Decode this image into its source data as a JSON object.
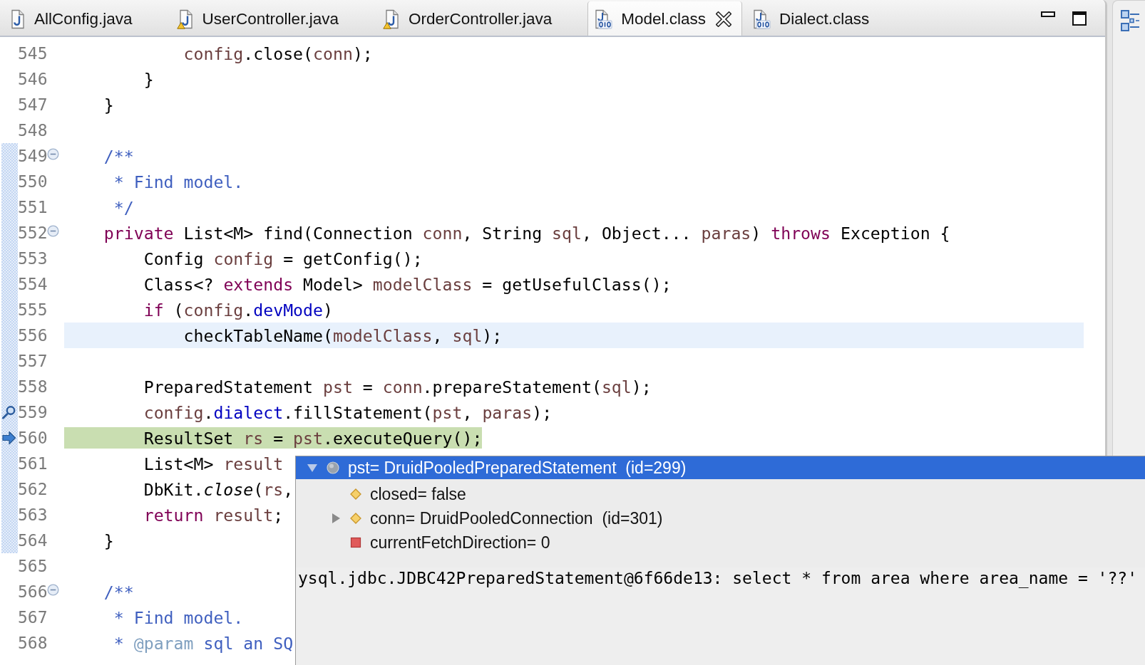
{
  "tabs": [
    {
      "label": "AllConfig.java",
      "kind": "java",
      "warning": false,
      "selected": false
    },
    {
      "label": "UserController.java",
      "kind": "java",
      "warning": true,
      "selected": false
    },
    {
      "label": "OrderController.java",
      "kind": "java",
      "warning": true,
      "selected": false
    },
    {
      "label": "Model.class",
      "kind": "class",
      "warning": false,
      "selected": true
    },
    {
      "label": "Dialect.class",
      "kind": "class",
      "warning": false,
      "selected": false
    }
  ],
  "editor": {
    "lines": [
      {
        "number": "545",
        "in_range": false,
        "tokens": [
          {
            "text": "            config",
            "kind": "variable"
          },
          {
            "text": ".close(",
            "kind": "plain"
          },
          {
            "text": "conn",
            "kind": "variable"
          },
          {
            "text": ");",
            "kind": "plain"
          }
        ]
      },
      {
        "number": "546",
        "in_range": false,
        "tokens": [
          {
            "text": "        }",
            "kind": "plain"
          }
        ]
      },
      {
        "number": "547",
        "in_range": false,
        "tokens": [
          {
            "text": "    }",
            "kind": "plain"
          }
        ]
      },
      {
        "number": "548",
        "in_range": false
      },
      {
        "number": "549",
        "in_range": true,
        "fold_expanded": true,
        "tokens": [
          {
            "text": "    /**",
            "kind": "javadoc"
          }
        ]
      },
      {
        "number": "550",
        "in_range": true,
        "tokens": [
          {
            "text": "     * Find model.",
            "kind": "javadoc"
          }
        ]
      },
      {
        "number": "551",
        "in_range": true,
        "tokens": [
          {
            "text": "     */",
            "kind": "javadoc"
          }
        ]
      },
      {
        "number": "552",
        "in_range": true,
        "fold_expanded": true,
        "tokens": [
          {
            "text": "    private",
            "kind": "keyword"
          },
          {
            "text": " List<M> find(Connection ",
            "kind": "plain"
          },
          {
            "text": "conn",
            "kind": "variable"
          },
          {
            "text": ", String ",
            "kind": "plain"
          },
          {
            "text": "sql",
            "kind": "variable"
          },
          {
            "text": ", Object... ",
            "kind": "plain"
          },
          {
            "text": "paras",
            "kind": "variable"
          },
          {
            "text": ") ",
            "kind": "plain"
          },
          {
            "text": "throws",
            "kind": "keyword"
          },
          {
            "text": " Exception {",
            "kind": "plain"
          }
        ]
      },
      {
        "number": "553",
        "in_range": true,
        "tokens": [
          {
            "text": "        Config ",
            "kind": "plain"
          },
          {
            "text": "config",
            "kind": "variable"
          },
          {
            "text": " = getConfig();",
            "kind": "plain"
          }
        ]
      },
      {
        "number": "554",
        "in_range": true,
        "tokens": [
          {
            "text": "        Class<? ",
            "kind": "plain"
          },
          {
            "text": "extends",
            "kind": "keyword"
          },
          {
            "text": " Model> ",
            "kind": "plain"
          },
          {
            "text": "modelClass",
            "kind": "variable"
          },
          {
            "text": " = getUsefulClass();",
            "kind": "plain"
          }
        ]
      },
      {
        "number": "555",
        "in_range": true,
        "tokens": [
          {
            "text": "        if",
            "kind": "keyword"
          },
          {
            "text": " (",
            "kind": "plain"
          },
          {
            "text": "config",
            "kind": "variable"
          },
          {
            "text": ".",
            "kind": "plain"
          },
          {
            "text": "devMode",
            "kind": "field"
          },
          {
            "text": ")",
            "kind": "plain"
          }
        ]
      },
      {
        "number": "556",
        "in_range": true,
        "current_line": true,
        "tokens": [
          {
            "text": "            checkTableName(",
            "kind": "plain"
          },
          {
            "text": "modelClass",
            "kind": "variable"
          },
          {
            "text": ", ",
            "kind": "plain"
          },
          {
            "text": "sql",
            "kind": "variable"
          },
          {
            "text": ");",
            "kind": "plain"
          }
        ]
      },
      {
        "number": "557",
        "in_range": true
      },
      {
        "number": "558",
        "in_range": true,
        "tokens": [
          {
            "text": "        PreparedStatement ",
            "kind": "plain"
          },
          {
            "text": "pst",
            "kind": "variable"
          },
          {
            "text": " = ",
            "kind": "plain"
          },
          {
            "text": "conn",
            "kind": "variable"
          },
          {
            "text": ".prepareStatement(",
            "kind": "plain"
          },
          {
            "text": "sql",
            "kind": "variable"
          },
          {
            "text": ");",
            "kind": "plain"
          }
        ]
      },
      {
        "number": "559",
        "in_range": true,
        "search_marker": true,
        "tokens": [
          {
            "text": "        config",
            "kind": "variable"
          },
          {
            "text": ".",
            "kind": "plain"
          },
          {
            "text": "dialect",
            "kind": "field"
          },
          {
            "text": ".fillStatement(",
            "kind": "plain"
          },
          {
            "text": "pst",
            "kind": "variable"
          },
          {
            "text": ", ",
            "kind": "plain"
          },
          {
            "text": "paras",
            "kind": "variable"
          },
          {
            "text": ");",
            "kind": "plain"
          }
        ]
      },
      {
        "number": "560",
        "in_range": true,
        "instruction_pointer": true,
        "execution_line": true,
        "tokens": [
          {
            "text": "        ResultSet ",
            "kind": "plain"
          },
          {
            "text": "rs",
            "kind": "variable"
          },
          {
            "text": " = ",
            "kind": "plain"
          },
          {
            "text": "pst",
            "kind": "variable"
          },
          {
            "text": ".executeQuery();",
            "kind": "plain"
          }
        ]
      },
      {
        "number": "561",
        "in_range": true,
        "tokens": [
          {
            "text": "        List<M> ",
            "kind": "plain"
          },
          {
            "text": "result",
            "kind": "variable"
          }
        ]
      },
      {
        "number": "562",
        "in_range": true,
        "tokens": [
          {
            "text": "        DbKit.",
            "kind": "plain"
          },
          {
            "text": "close",
            "kind": "static_method"
          },
          {
            "text": "(",
            "kind": "plain"
          },
          {
            "text": "rs",
            "kind": "variable"
          },
          {
            "text": ",",
            "kind": "plain"
          }
        ]
      },
      {
        "number": "563",
        "in_range": true,
        "tokens": [
          {
            "text": "        return",
            "kind": "keyword"
          },
          {
            "text": " result",
            "kind": "variable"
          },
          {
            "text": ";",
            "kind": "plain"
          }
        ]
      },
      {
        "number": "564",
        "in_range": true,
        "tokens": [
          {
            "text": "    }",
            "kind": "plain"
          }
        ]
      },
      {
        "number": "565",
        "in_range": false
      },
      {
        "number": "566",
        "in_range": false,
        "fold_expanded": true,
        "tokens": [
          {
            "text": "    /**",
            "kind": "javadoc"
          }
        ]
      },
      {
        "number": "567",
        "in_range": false,
        "tokens": [
          {
            "text": "     * Find model.",
            "kind": "javadoc"
          }
        ]
      },
      {
        "number": "568",
        "in_range": false,
        "tokens": [
          {
            "text": "     * ",
            "kind": "javadoc"
          },
          {
            "text": "@param",
            "kind": "javadoc_tag"
          },
          {
            "text": " sql an SQ",
            "kind": "javadoc"
          }
        ]
      }
    ]
  },
  "hover_popup": {
    "tree": [
      {
        "label": "pst= DruidPooledPreparedStatement  (id=299)",
        "kind": "local",
        "expanded": true,
        "selected": true,
        "children": [
          {
            "label": "closed= false",
            "kind": "protected",
            "selected": false
          },
          {
            "label": "conn= DruidPooledConnection  (id=301)",
            "kind": "protected",
            "expanded": false,
            "selected": false
          },
          {
            "label": "currentFetchDirection= 0",
            "kind": "private",
            "selected": false
          }
        ]
      }
    ],
    "detail": "ysql.jdbc.JDBC42PreparedStatement@6f66de13: select * from area where area_name = '??'"
  }
}
